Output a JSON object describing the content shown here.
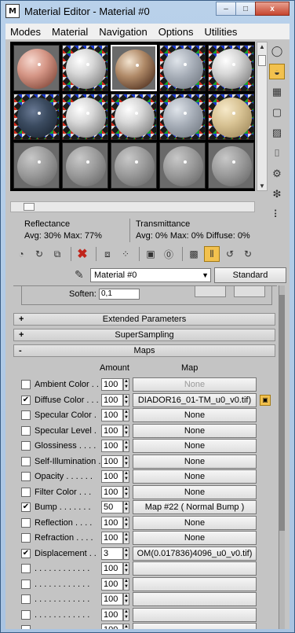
{
  "window": {
    "title": "Material Editor - Material #0",
    "app_icon": "M",
    "buttons": {
      "minimize": "–",
      "maximize": "□",
      "close": "x"
    }
  },
  "menu": [
    "Modes",
    "Material",
    "Navigation",
    "Options",
    "Utilities"
  ],
  "slots": [
    {
      "style": "skin",
      "bg": "grey",
      "selected": false
    },
    {
      "style": "white",
      "bg": "checker",
      "selected": false
    },
    {
      "style": "leopard",
      "bg": "grey",
      "selected": true
    },
    {
      "style": "fabric",
      "bg": "checker",
      "selected": false
    },
    {
      "style": "white",
      "bg": "checker",
      "selected": false
    },
    {
      "style": "dark",
      "bg": "checker",
      "selected": false
    },
    {
      "style": "white",
      "bg": "checker",
      "selected": false
    },
    {
      "style": "white",
      "bg": "checker",
      "selected": false
    },
    {
      "style": "fabric",
      "bg": "checker",
      "selected": false
    },
    {
      "style": "tiles",
      "bg": "checker",
      "selected": false
    },
    {
      "style": "grey",
      "bg": "grey",
      "selected": false
    },
    {
      "style": "grey",
      "bg": "grey",
      "selected": false
    },
    {
      "style": "grey",
      "bg": "grey",
      "selected": false
    },
    {
      "style": "grey",
      "bg": "grey",
      "selected": false
    },
    {
      "style": "grey",
      "bg": "grey",
      "selected": false
    }
  ],
  "side_tools": [
    {
      "name": "sample-type-icon",
      "glyph": "◯",
      "active": false
    },
    {
      "name": "backlight-icon",
      "glyph": "◒",
      "active": true
    },
    {
      "name": "background-icon",
      "glyph": "▦",
      "active": false
    },
    {
      "name": "uv-tiling-icon",
      "glyph": "▢",
      "active": false
    },
    {
      "name": "video-color-check-icon",
      "glyph": "▨",
      "active": false
    },
    {
      "name": "make-preview-icon",
      "glyph": "⌷",
      "active": false
    },
    {
      "name": "options-icon",
      "glyph": "⚙",
      "active": false
    },
    {
      "name": "select-by-material-icon",
      "glyph": "❇",
      "active": false
    },
    {
      "name": "material-navigator-icon",
      "glyph": "⠇",
      "active": false
    }
  ],
  "stats": {
    "reflectance_label": "Reflectance",
    "reflectance_values": "Avg:  30% Max:  77%",
    "transmittance_label": "Transmittance",
    "transmittance_values": "Avg:    0% Max:    0%  Diffuse:   0%"
  },
  "toolbar": [
    {
      "name": "get-material-icon",
      "glyph": "◔",
      "active": false
    },
    {
      "name": "put-to-scene-icon",
      "glyph": "↻",
      "active": false
    },
    {
      "name": "assign-to-selection-icon",
      "glyph": "⧉",
      "active": false
    },
    {
      "name": "sep",
      "glyph": "",
      "active": false
    },
    {
      "name": "reset-map-icon",
      "glyph": "✖",
      "active": false,
      "red": true
    },
    {
      "name": "sep",
      "glyph": "",
      "active": false
    },
    {
      "name": "copy-material-icon",
      "glyph": "⧈",
      "active": false
    },
    {
      "name": "make-unique-icon",
      "glyph": "⁘",
      "active": false
    },
    {
      "name": "sep",
      "glyph": "",
      "active": false
    },
    {
      "name": "put-to-library-icon",
      "glyph": "▣",
      "active": false
    },
    {
      "name": "material-id-channel-icon",
      "glyph": "⓪",
      "active": false
    },
    {
      "name": "sep",
      "glyph": "",
      "active": false
    },
    {
      "name": "show-shaded-material-icon",
      "glyph": "▩",
      "active": false
    },
    {
      "name": "show-end-result-icon",
      "glyph": "⫴",
      "active": true
    },
    {
      "name": "go-to-parent-icon",
      "glyph": "↺",
      "active": false
    },
    {
      "name": "go-forward-to-sibling-icon",
      "glyph": "↻",
      "active": false
    }
  ],
  "material": {
    "name": "Material #0",
    "type": "Standard"
  },
  "soften": {
    "label": "Soften:",
    "value": "0,1"
  },
  "rollouts": {
    "extended": {
      "sign": "+",
      "title": "Extended Parameters"
    },
    "supersampling": {
      "sign": "+",
      "title": "SuperSampling"
    },
    "maps": {
      "sign": "-",
      "title": "Maps"
    }
  },
  "maps_header": {
    "amount": "Amount",
    "map": "Map"
  },
  "maps": [
    {
      "label": "Ambient Color . .",
      "checked": false,
      "amount": "100",
      "map": "None",
      "state": "disabled",
      "lock": false
    },
    {
      "label": "Diffuse Color . . .",
      "checked": true,
      "amount": "100",
      "map": "DIADOR16_01-TM_u0_v0.tif)",
      "state": "normal",
      "lock": true
    },
    {
      "label": "Specular Color  .",
      "checked": false,
      "amount": "100",
      "map": "None",
      "state": "normal",
      "lock": false
    },
    {
      "label": "Specular Level  .",
      "checked": false,
      "amount": "100",
      "map": "None",
      "state": "normal",
      "lock": false
    },
    {
      "label": "Glossiness  . . . .",
      "checked": false,
      "amount": "100",
      "map": "None",
      "state": "normal",
      "lock": false
    },
    {
      "label": "Self-Illumination .",
      "checked": false,
      "amount": "100",
      "map": "None",
      "state": "normal",
      "lock": false
    },
    {
      "label": "Opacity . . . . . .",
      "checked": false,
      "amount": "100",
      "map": "None",
      "state": "normal",
      "lock": false
    },
    {
      "label": "Filter Color  . . .",
      "checked": false,
      "amount": "100",
      "map": "None",
      "state": "normal",
      "lock": false
    },
    {
      "label": "Bump  . . . . . . .",
      "checked": true,
      "amount": "50",
      "map": "Map #22  ( Normal Bump )",
      "state": "normal",
      "lock": false
    },
    {
      "label": "Reflection  . . . .",
      "checked": false,
      "amount": "100",
      "map": "None",
      "state": "normal",
      "lock": false
    },
    {
      "label": "Refraction  . . . .",
      "checked": false,
      "amount": "100",
      "map": "None",
      "state": "normal",
      "lock": false
    },
    {
      "label": "Displacement . .",
      "checked": true,
      "amount": "3",
      "map": "OM(0.017836)4096_u0_v0.tif)",
      "state": "normal",
      "lock": false
    },
    {
      "label": ". . . . . . . . . . . .",
      "checked": false,
      "amount": "100",
      "map": "",
      "state": "blank",
      "lock": false
    },
    {
      "label": ". . . . . . . . . . . .",
      "checked": false,
      "amount": "100",
      "map": "",
      "state": "blank",
      "lock": false
    },
    {
      "label": ". . . . . . . . . . . .",
      "checked": false,
      "amount": "100",
      "map": "",
      "state": "blank",
      "lock": false
    },
    {
      "label": ". . . . . . . . . . . .",
      "checked": false,
      "amount": "100",
      "map": "",
      "state": "blank",
      "lock": false
    },
    {
      "label": ". . . . . . . . . . . .",
      "checked": false,
      "amount": "100",
      "map": "",
      "state": "blank",
      "lock": false
    }
  ]
}
